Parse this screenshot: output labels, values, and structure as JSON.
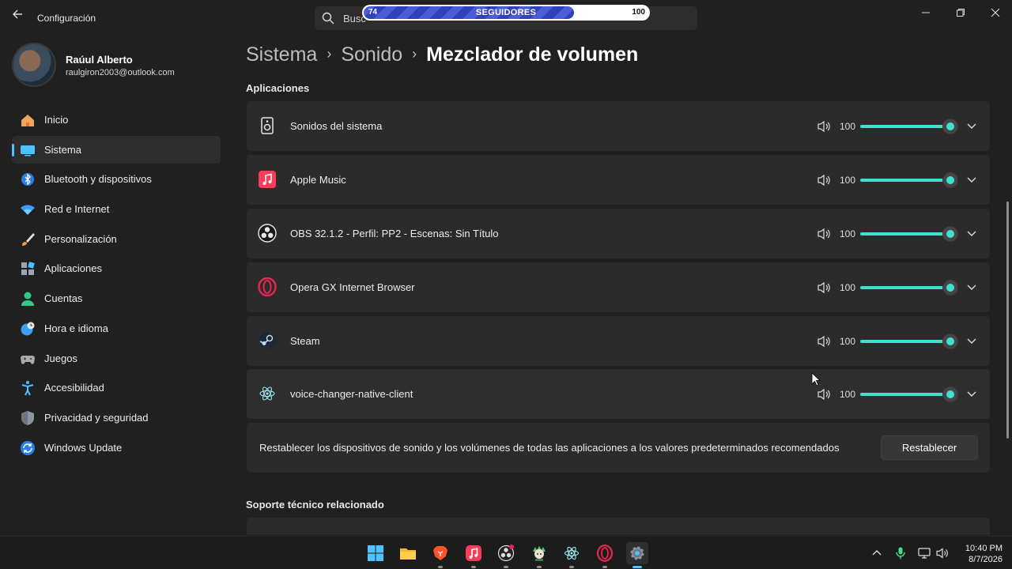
{
  "window": {
    "title": "Configuración",
    "search_placeholder": "Busc"
  },
  "overlay": {
    "label": "SEGUIDORES",
    "min": "74",
    "max": "100",
    "progress": 0.74
  },
  "profile": {
    "name": "Raúul Alberto",
    "email": "raulgiron2003@outlook.com"
  },
  "sidebar": {
    "items": [
      {
        "label": "Inicio",
        "icon": "home-icon"
      },
      {
        "label": "Sistema",
        "icon": "system-icon",
        "active": true
      },
      {
        "label": "Bluetooth y dispositivos",
        "icon": "bluetooth-icon"
      },
      {
        "label": "Red e Internet",
        "icon": "wifi-icon"
      },
      {
        "label": "Personalización",
        "icon": "brush-icon"
      },
      {
        "label": "Aplicaciones",
        "icon": "apps-icon"
      },
      {
        "label": "Cuentas",
        "icon": "account-icon"
      },
      {
        "label": "Hora e idioma",
        "icon": "clock-globe-icon"
      },
      {
        "label": "Juegos",
        "icon": "gamepad-icon"
      },
      {
        "label": "Accesibilidad",
        "icon": "accessibility-icon"
      },
      {
        "label": "Privacidad y seguridad",
        "icon": "shield-icon"
      },
      {
        "label": "Windows Update",
        "icon": "update-icon"
      }
    ]
  },
  "breadcrumb": {
    "parts": [
      "Sistema",
      "Sonido"
    ],
    "current": "Mezclador de volumen"
  },
  "apps_section": {
    "title": "Aplicaciones",
    "apps": [
      {
        "name": "Sonidos del sistema",
        "icon": "speaker-icon",
        "volume": "100",
        "level": 1.0
      },
      {
        "name": "Apple Music",
        "icon": "apple-music-icon",
        "volume": "100",
        "level": 1.0
      },
      {
        "name": "OBS 32.1.2 - Perfil: PP2 - Escenas: Sin Título",
        "icon": "obs-icon",
        "volume": "100",
        "level": 1.0
      },
      {
        "name": "Opera GX Internet Browser",
        "icon": "opera-gx-icon",
        "volume": "100",
        "level": 1.0
      },
      {
        "name": "Steam",
        "icon": "steam-icon",
        "volume": "100",
        "level": 1.0
      },
      {
        "name": "voice-changer-native-client",
        "icon": "electron-icon",
        "volume": "100",
        "level": 1.0
      }
    ]
  },
  "reset": {
    "text": "Restablecer los dispositivos de sonido y los volúmenes de todas las aplicaciones a los valores predeterminados recomendados",
    "button": "Restablecer"
  },
  "support_section": {
    "title": "Soporte técnico relacionado"
  },
  "taskbar": {
    "apps": [
      "windows-start-icon",
      "file-explorer-icon",
      "brave-icon",
      "apple-music-icon",
      "obs-icon",
      "app-character-icon",
      "electron-icon",
      "opera-gx-icon",
      "settings-icon"
    ],
    "active_app": "settings-icon",
    "time": "10:40 PM",
    "date": "8/7/2026"
  },
  "colors": {
    "accent": "#4cc2ff",
    "slider": "#3fe0d0",
    "card": "#2b2b2b",
    "background": "#202020"
  }
}
